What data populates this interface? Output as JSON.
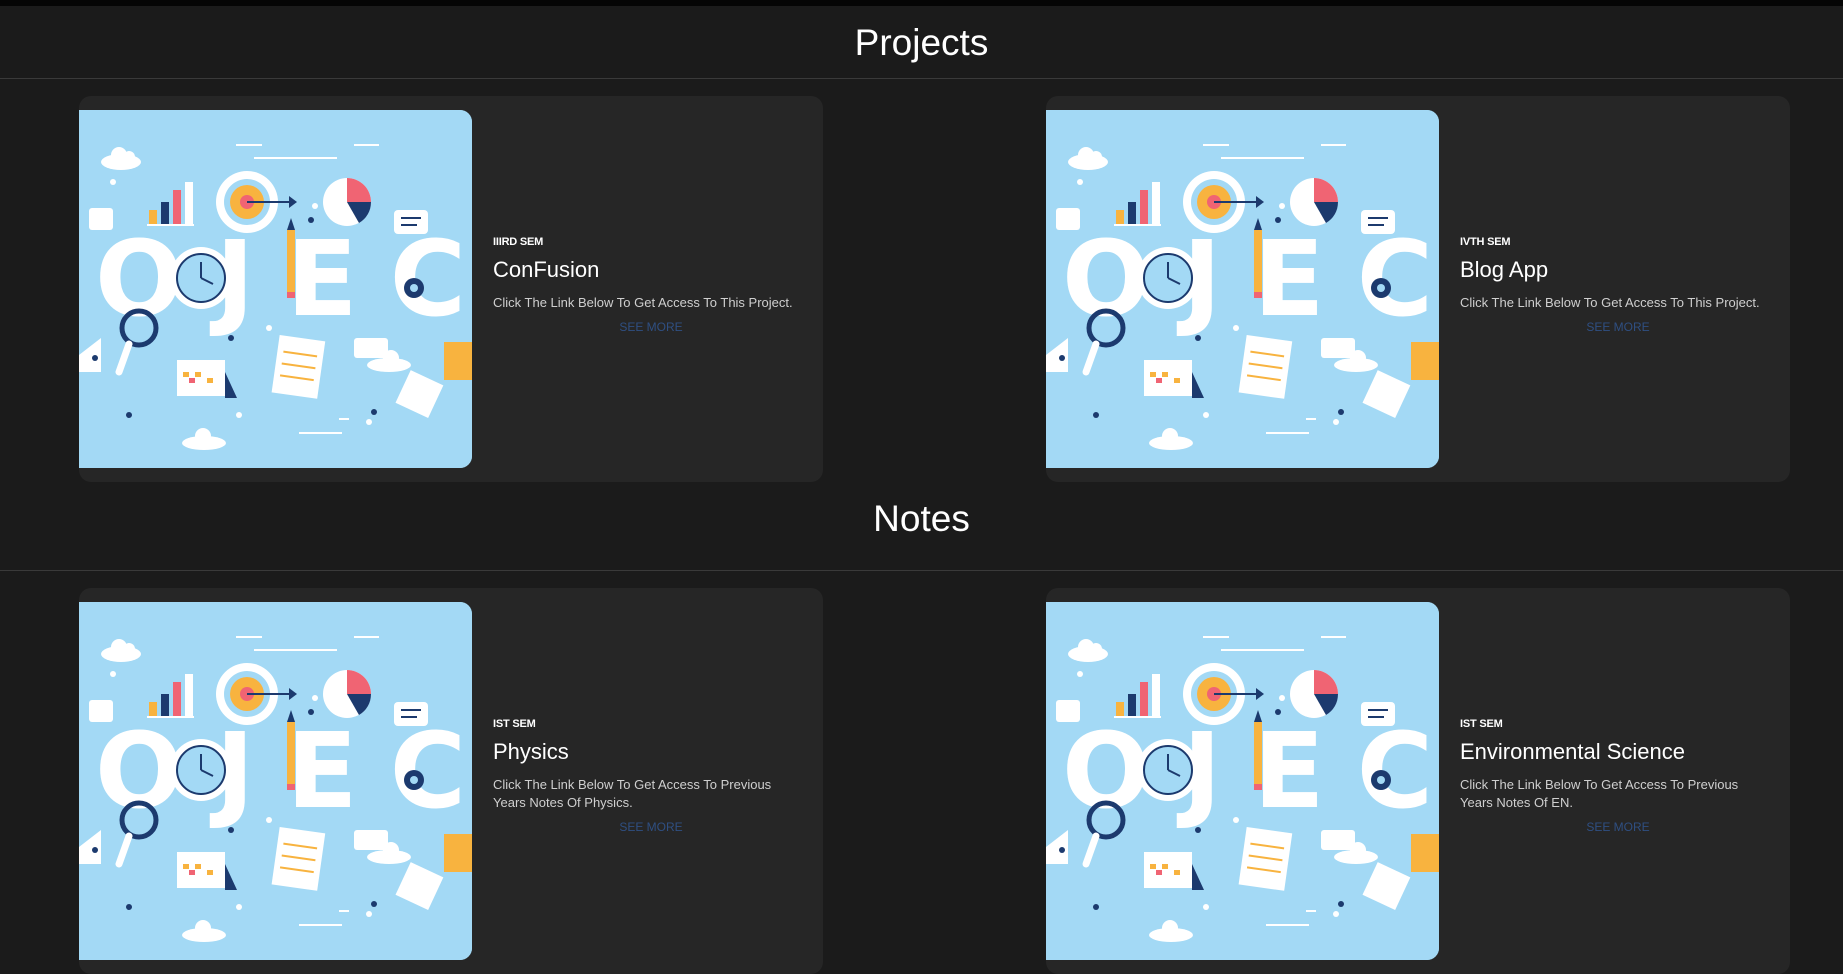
{
  "sections": {
    "projects": {
      "title": "Projects",
      "cards": [
        {
          "semester": "IIIRD SEM",
          "title": "ConFusion",
          "description": "Click The Link Below To Get Access To This Project.",
          "link": "SEE MORE"
        },
        {
          "semester": "IVTH SEM",
          "title": "Blog App",
          "description": "Click The Link Below To Get Access To This Project.",
          "link": "SEE MORE"
        }
      ]
    },
    "notes": {
      "title": "Notes",
      "cards": [
        {
          "semester": "IST SEM",
          "title": "Physics",
          "description": "Click The Link Below To Get Access To Previous Years Notes Of Physics.",
          "link": "SEE MORE"
        },
        {
          "semester": "IST SEM",
          "title": "Environmental Science",
          "description": "Click The Link Below To Get Access To Previous Years Notes Of EN.",
          "link": "SEE MORE"
        }
      ]
    }
  },
  "image": {
    "icon": "project-illustration-icon",
    "word": "PROJECT"
  },
  "colors": {
    "background": "#1b1b1b",
    "card": "#262626",
    "illustration_bg": "#a3d9f5",
    "link": "#2f4f82",
    "accent_red": "#f06473",
    "accent_orange": "#f8b33f",
    "navy": "#1c3a6e"
  }
}
